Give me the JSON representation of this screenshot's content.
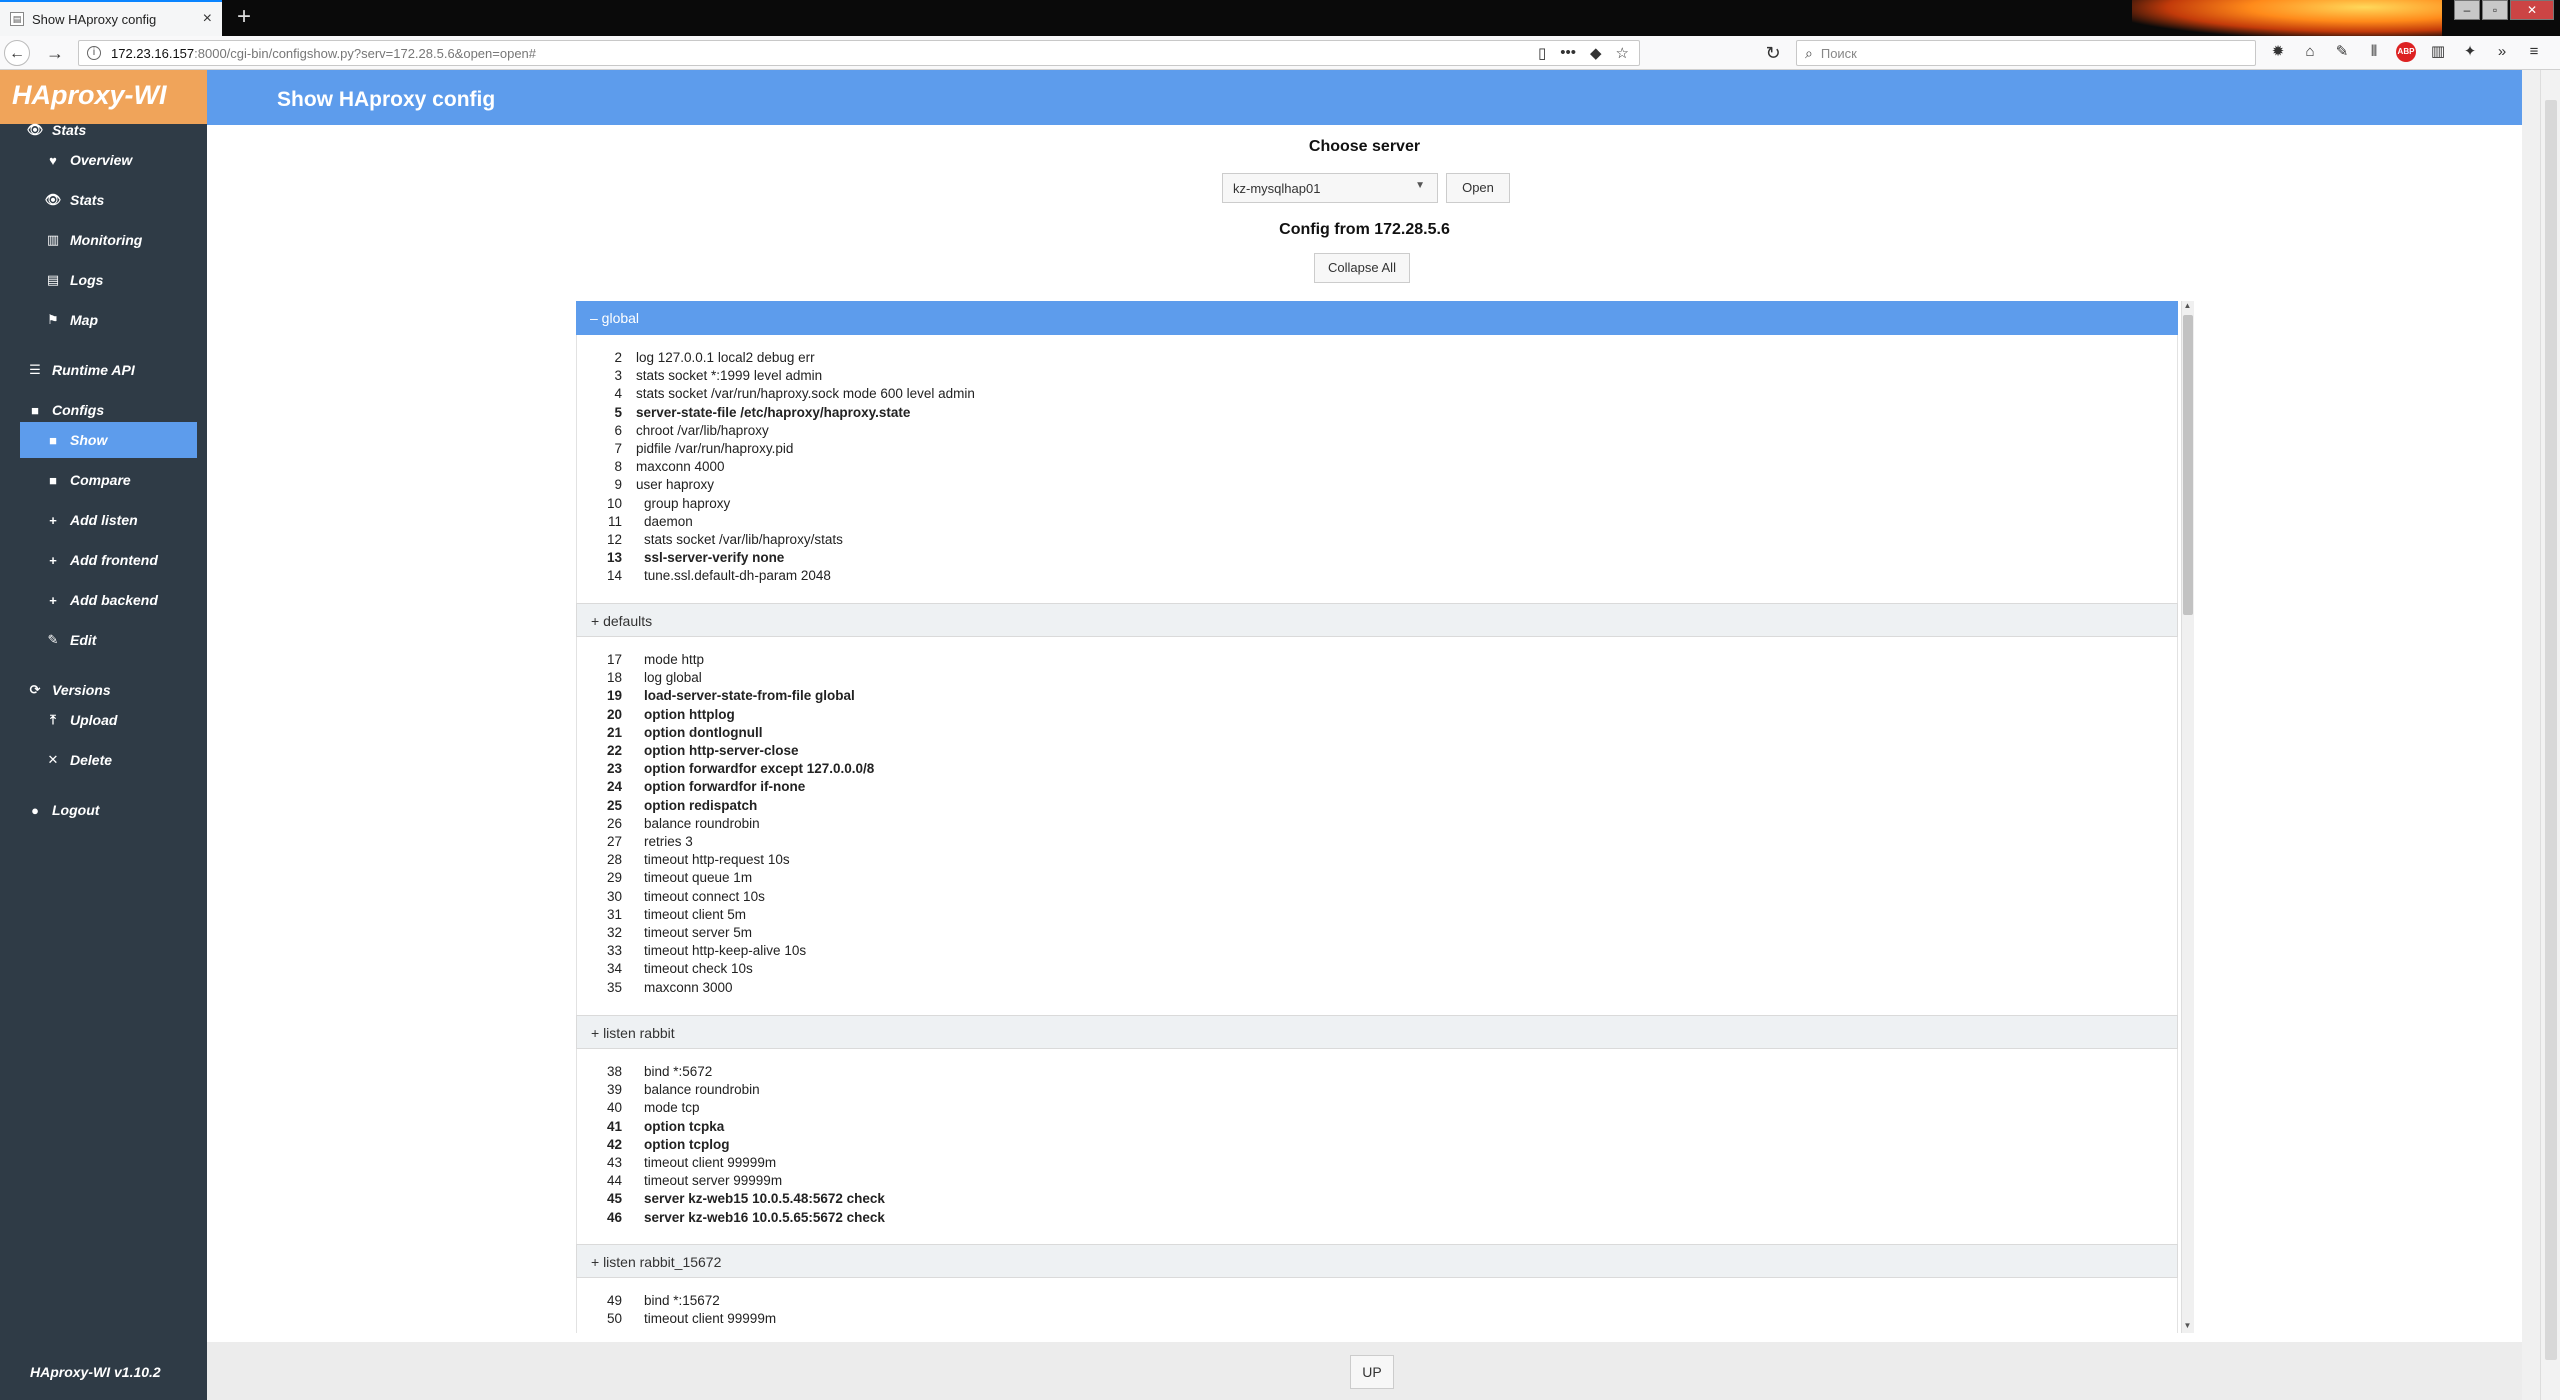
{
  "browser": {
    "tab_title": "Show HAproxy config",
    "tab_close": "×",
    "new_tab": "+",
    "url_host": "172.23.16.157",
    "url_rest": ":8000/cgi-bin/configshow.py?serv=172.28.5.6&open=open#",
    "search_placeholder": "Поиск"
  },
  "app": {
    "logo": "HAproxy-WI",
    "page_title": "Show HAproxy config",
    "version": "HAproxy-WI v1.10.2",
    "collapse_toggle": "←"
  },
  "sidebar": [
    {
      "label": "Stats",
      "icon": "eye-icon",
      "glyph": "👁",
      "type": "group"
    },
    {
      "label": "Overview",
      "icon": "heart-icon",
      "glyph": "♥",
      "type": "sub"
    },
    {
      "label": "Stats",
      "icon": "eye-icon",
      "glyph": "👁",
      "type": "sub"
    },
    {
      "label": "Monitoring",
      "icon": "chart-icon",
      "glyph": "▥",
      "type": "sub"
    },
    {
      "label": "Logs",
      "icon": "book-icon",
      "glyph": "▤",
      "type": "sub"
    },
    {
      "label": "Map",
      "icon": "map-icon",
      "glyph": "⚑",
      "type": "sub"
    },
    {
      "label": "Runtime API",
      "icon": "server-icon",
      "glyph": "☰",
      "type": "group"
    },
    {
      "label": "Configs",
      "icon": "file-icon",
      "glyph": "■",
      "type": "group"
    },
    {
      "label": "Show",
      "icon": "file-icon",
      "glyph": "■",
      "type": "sub",
      "active": true
    },
    {
      "label": "Compare",
      "icon": "file-icon",
      "glyph": "■",
      "type": "sub"
    },
    {
      "label": "Add listen",
      "icon": "plus-icon",
      "glyph": "+",
      "type": "sub"
    },
    {
      "label": "Add frontend",
      "icon": "plus-icon",
      "glyph": "+",
      "type": "sub"
    },
    {
      "label": "Add backend",
      "icon": "plus-icon",
      "glyph": "+",
      "type": "sub"
    },
    {
      "label": "Edit",
      "icon": "edit-icon",
      "glyph": "✎",
      "type": "sub"
    },
    {
      "label": "Versions",
      "icon": "refresh-icon",
      "glyph": "⟳",
      "type": "group"
    },
    {
      "label": "Upload",
      "icon": "upload-icon",
      "glyph": "⤒",
      "type": "sub"
    },
    {
      "label": "Delete",
      "icon": "close-icon",
      "glyph": "✕",
      "type": "sub"
    },
    {
      "label": "Logout",
      "icon": "user-icon",
      "glyph": "●",
      "type": "group"
    }
  ],
  "controls": {
    "choose_server": "Choose server",
    "selected_server": "kz-mysqlhap01",
    "open_label": "Open",
    "config_from": "Config from 172.28.5.6",
    "collapse_all": "Collapse All",
    "up_label": "UP"
  },
  "sections": [
    {
      "header": "– global",
      "open": true,
      "lines": [
        {
          "n": "2",
          "text": "log 127.0.0.1 local2 debug err",
          "indent": 0
        },
        {
          "n": "3",
          "text": "stats socket *:1999 level admin",
          "indent": 0
        },
        {
          "n": "4",
          "text": "stats socket /var/run/haproxy.sock mode 600 level admin",
          "indent": 0
        },
        {
          "n": "5",
          "text": "server-state-file /etc/haproxy/haproxy.state",
          "indent": 0,
          "bold": true
        },
        {
          "n": "6",
          "text": "chroot /var/lib/haproxy",
          "indent": 0
        },
        {
          "n": "7",
          "text": "pidfile /var/run/haproxy.pid",
          "indent": 0
        },
        {
          "n": "8",
          "text": "maxconn 4000",
          "indent": 0
        },
        {
          "n": "9",
          "text": "user haproxy",
          "indent": 0
        },
        {
          "n": "10",
          "text": "group haproxy",
          "indent": 1
        },
        {
          "n": "11",
          "text": "daemon",
          "indent": 1
        },
        {
          "n": "12",
          "text": "stats socket /var/lib/haproxy/stats",
          "indent": 1
        },
        {
          "n": "13",
          "text": "ssl-server-verify none",
          "indent": 1,
          "bold": true
        },
        {
          "n": "14",
          "text": "tune.ssl.default-dh-param 2048",
          "indent": 1
        }
      ]
    },
    {
      "header": "+ defaults",
      "open": false,
      "lines": [
        {
          "n": "17",
          "text": "mode http",
          "indent": 1
        },
        {
          "n": "18",
          "text": "log global",
          "indent": 1
        },
        {
          "n": "19",
          "text": "load-server-state-from-file global",
          "indent": 1,
          "bold": true
        },
        {
          "n": "20",
          "text": "option httplog",
          "indent": 1,
          "bold": true
        },
        {
          "n": "21",
          "text": "option dontlognull",
          "indent": 1,
          "bold": true
        },
        {
          "n": "22",
          "text": "option http-server-close",
          "indent": 1,
          "bold": true
        },
        {
          "n": "23",
          "text": "option forwardfor except 127.0.0.0/8",
          "indent": 1,
          "bold": true
        },
        {
          "n": "24",
          "text": "option forwardfor if-none",
          "indent": 1,
          "bold": true
        },
        {
          "n": "25",
          "text": "option redispatch",
          "indent": 1,
          "bold": true
        },
        {
          "n": "26",
          "text": "balance roundrobin",
          "indent": 1
        },
        {
          "n": "27",
          "text": "retries 3",
          "indent": 1
        },
        {
          "n": "28",
          "text": "timeout http-request 10s",
          "indent": 1
        },
        {
          "n": "29",
          "text": "timeout queue 1m",
          "indent": 1
        },
        {
          "n": "30",
          "text": "timeout connect 10s",
          "indent": 1
        },
        {
          "n": "31",
          "text": "timeout client 5m",
          "indent": 1
        },
        {
          "n": "32",
          "text": "timeout server 5m",
          "indent": 1
        },
        {
          "n": "33",
          "text": "timeout http-keep-alive 10s",
          "indent": 1
        },
        {
          "n": "34",
          "text": "timeout check 10s",
          "indent": 1
        },
        {
          "n": "35",
          "text": "maxconn 3000",
          "indent": 1
        }
      ]
    },
    {
      "header": "+ listen rabbit",
      "open": false,
      "lines": [
        {
          "n": "38",
          "text": "bind *:5672",
          "indent": 1
        },
        {
          "n": "39",
          "text": "balance roundrobin",
          "indent": 1
        },
        {
          "n": "40",
          "text": "mode tcp",
          "indent": 1
        },
        {
          "n": "41",
          "text": "option tcpka",
          "indent": 1,
          "bold": true
        },
        {
          "n": "42",
          "text": "option tcplog",
          "indent": 1,
          "bold": true
        },
        {
          "n": "43",
          "text": "timeout client 99999m",
          "indent": 1
        },
        {
          "n": "44",
          "text": "timeout server 99999m",
          "indent": 1
        },
        {
          "n": "45",
          "text": "server kz-web15 10.0.5.48:5672 check",
          "indent": 1,
          "bold": true
        },
        {
          "n": "46",
          "text": "server kz-web16 10.0.5.65:5672 check",
          "indent": 1,
          "bold": true
        }
      ]
    },
    {
      "header": "+ listen rabbit_15672",
      "open": false,
      "lines": [
        {
          "n": "49",
          "text": "bind *:15672",
          "indent": 1
        },
        {
          "n": "50",
          "text": "timeout client 99999m",
          "indent": 1
        }
      ]
    }
  ]
}
